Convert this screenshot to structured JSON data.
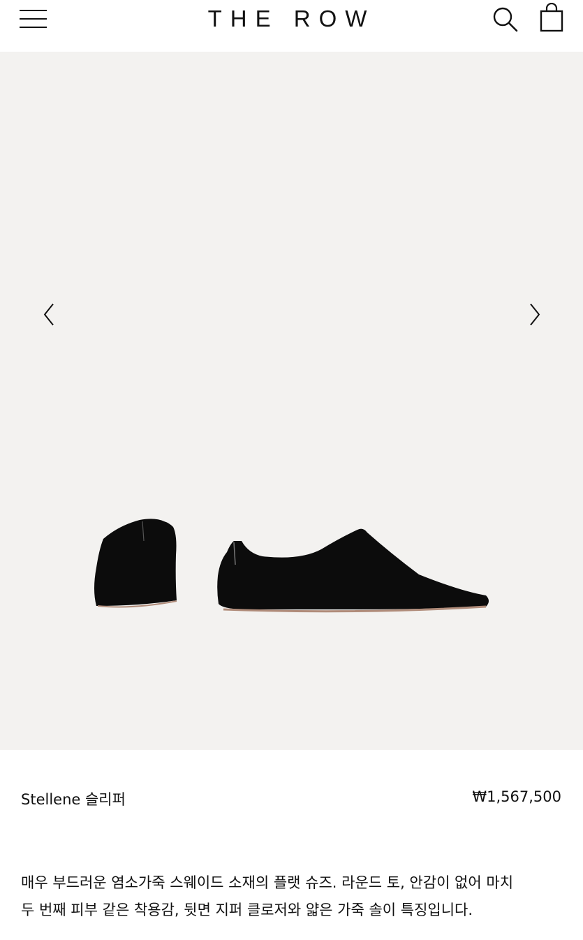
{
  "header": {
    "logo_text": "THE ROW",
    "menu_icon": "hamburger-menu-icon",
    "search_icon": "search-icon",
    "bag_icon": "shopping-bag-icon"
  },
  "gallery": {
    "prev_icon": "chevron-left-icon",
    "next_icon": "chevron-right-icon",
    "background_color": "#f3f2f0",
    "product_color": "#0c0c0c"
  },
  "product": {
    "name": "Stellene 슬리퍼",
    "price": "₩1,567,500",
    "description_line1": "매우 부드러운 염소가죽 스웨이드 소재의 플랫 슈즈. 라운드 토, 안감이 없어 마치",
    "description_line2": "두 번째 피부 같은 착용감, 뒷면 지퍼 클로저와 얇은 가죽 솔이 특징입니다."
  }
}
